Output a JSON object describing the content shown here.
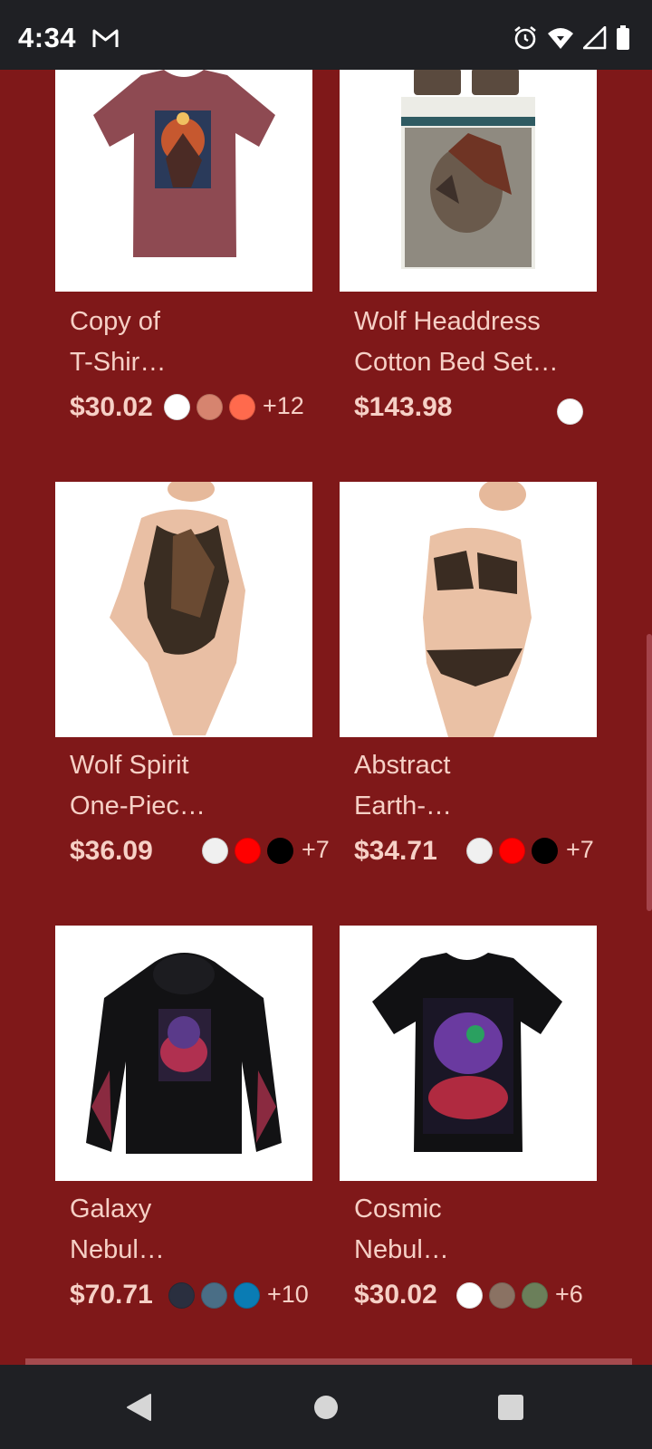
{
  "status_bar": {
    "time": "4:34",
    "icons": [
      "gmail-icon",
      "alarm-icon",
      "wifi-icon",
      "signal-icon",
      "battery-icon"
    ]
  },
  "products": [
    {
      "title": "Copy of\nT-Shir…",
      "price": "$30.02",
      "swatches": [
        "#ffffff",
        "#d6846f",
        "#ff6a4d"
      ],
      "more": "+12",
      "image": "maroon-tshirt-horse-print"
    },
    {
      "title": "Wolf Headdress\nCotton Bed Set…",
      "price": "$143.98",
      "swatches": [
        "#ffffff"
      ],
      "more": "",
      "image": "wolf-headdress-bed-set"
    },
    {
      "title": "Wolf Spirit\nOne-Piec…",
      "price": "$36.09",
      "swatches": [
        "#f0f0f0",
        "#ff0000",
        "#000000"
      ],
      "more": "+7",
      "image": "wolf-spirit-swimsuit"
    },
    {
      "title": "Abstract\nEarth-…",
      "price": "$34.71",
      "swatches": [
        "#f0f0f0",
        "#ff0000",
        "#000000"
      ],
      "more": "+7",
      "image": "abstract-earth-bikini"
    },
    {
      "title": "Galaxy\nNebul…",
      "price": "$70.71",
      "swatches": [
        "#2a2f3f",
        "#4a6e86",
        "#0a7cb4"
      ],
      "more": "+10",
      "image": "galaxy-nebula-hoodie"
    },
    {
      "title": "Cosmic\nNebul…",
      "price": "$30.02",
      "swatches": [
        "#ffffff",
        "#8a7263",
        "#6b7f5a"
      ],
      "more": "+6",
      "image": "cosmic-nebula-tshirt"
    }
  ],
  "nav_bar": {
    "buttons": [
      "back-icon",
      "home-icon",
      "recents-icon"
    ]
  }
}
